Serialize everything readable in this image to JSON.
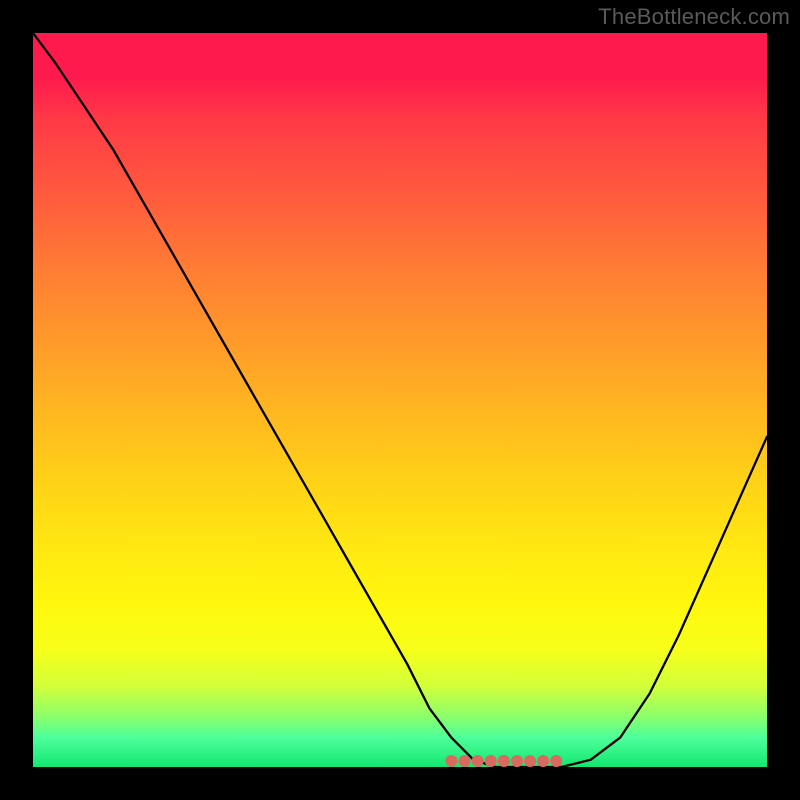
{
  "watermark": "TheBottleneck.com",
  "colors": {
    "page_bg": "#000000",
    "watermark_text": "#5a5a5a",
    "curve_stroke": "#000000",
    "floor_dots": "#d86a5f"
  },
  "chart_data": {
    "type": "line",
    "title": "",
    "xlabel": "",
    "ylabel": "",
    "xlim": [
      0,
      100
    ],
    "ylim": [
      0,
      100
    ],
    "grid": false,
    "x": [
      0,
      3,
      7,
      11,
      15,
      19,
      23,
      27,
      31,
      35,
      39,
      43,
      47,
      51,
      54,
      57,
      60,
      63,
      66,
      69,
      72,
      76,
      80,
      84,
      88,
      92,
      96,
      100
    ],
    "values": [
      100,
      96,
      90,
      84,
      77,
      70,
      63,
      56,
      49,
      42,
      35,
      28,
      21,
      14,
      8,
      4,
      1,
      0,
      0,
      0,
      0,
      1,
      4,
      10,
      18,
      27,
      36,
      45
    ],
    "floor_segment": {
      "x_start": 57,
      "x_end": 72,
      "y": 0
    },
    "annotations": []
  }
}
